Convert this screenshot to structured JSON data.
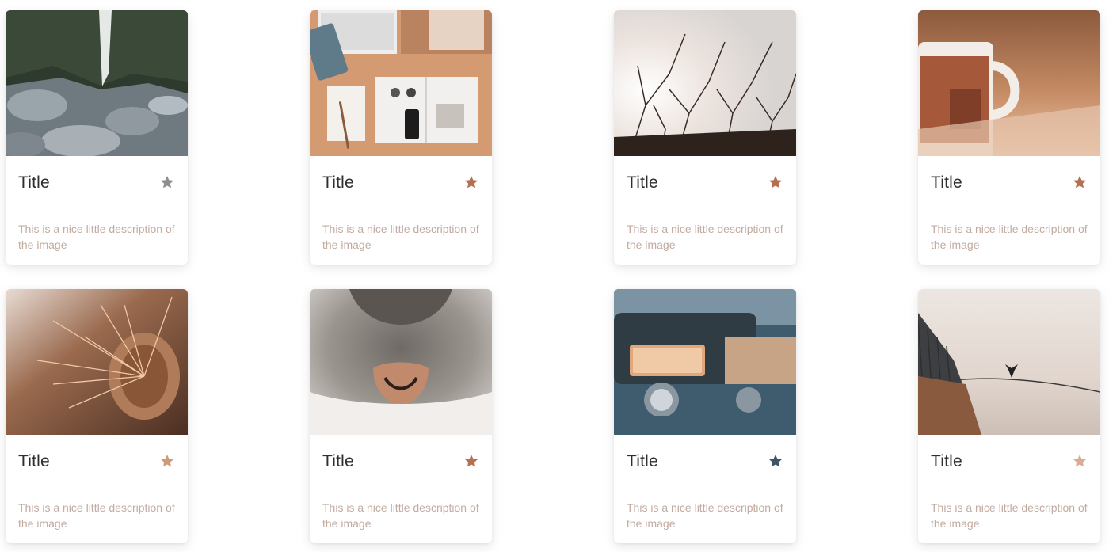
{
  "gallery": {
    "cards": [
      {
        "title": "Title",
        "description": "This is a nice little description of the image",
        "image": "waterfall-rocks-photo",
        "star_color": "#8e8e8e"
      },
      {
        "title": "Title",
        "description": "This is a nice little description of the image",
        "image": "desk-flatlay-photo",
        "star_color": "#b4704f"
      },
      {
        "title": "Title",
        "description": "This is a nice little description of the image",
        "image": "branches-sky-photo",
        "star_color": "#b4704f"
      },
      {
        "title": "Title",
        "description": "This is a nice little description of the image",
        "image": "coffee-mug-photo",
        "star_color": "#b4704f"
      },
      {
        "title": "Title",
        "description": "This is a nice little description of the image",
        "image": "spiky-plant-photo",
        "star_color": "#d09a76"
      },
      {
        "title": "Title",
        "description": "This is a nice little description of the image",
        "image": "cat-nose-photo",
        "star_color": "#b4704f"
      },
      {
        "title": "Title",
        "description": "This is a nice little description of the image",
        "image": "tuk-tuk-photo",
        "star_color": "#3d5566"
      },
      {
        "title": "Title",
        "description": "This is a nice little description of the image",
        "image": "boat-bird-photo",
        "star_color": "#d9ab92"
      }
    ]
  }
}
